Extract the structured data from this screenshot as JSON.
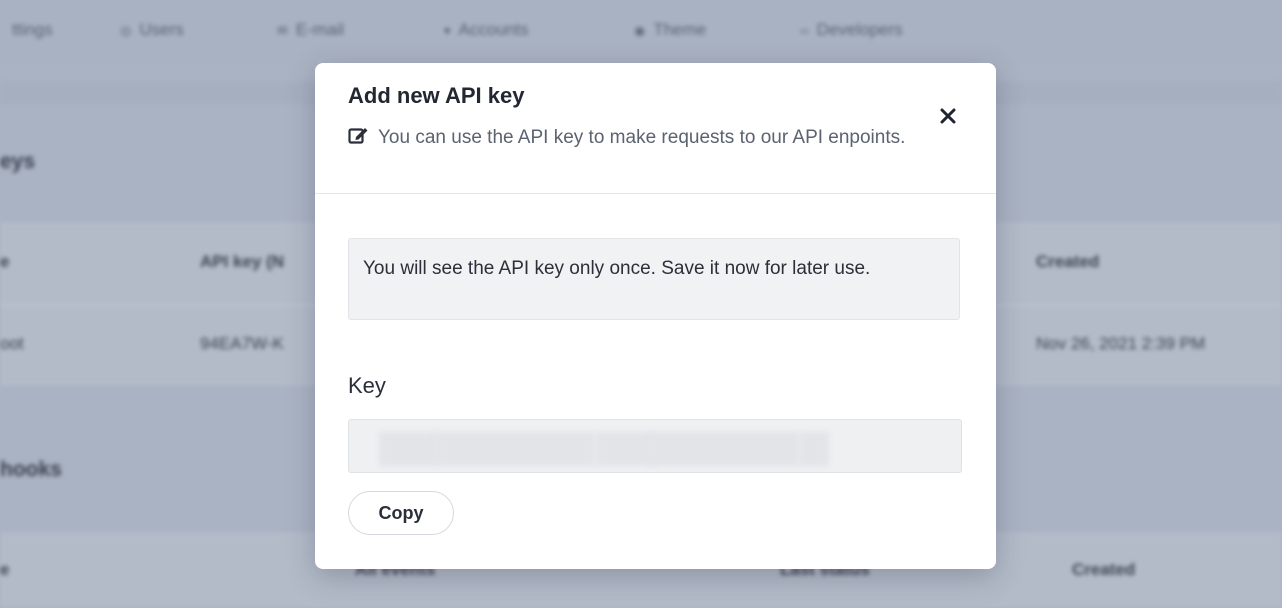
{
  "background": {
    "nav": [
      {
        "icon": "settings-icon",
        "glyph": "",
        "label": "ttings"
      },
      {
        "icon": "users-icon",
        "glyph": "◎",
        "label": "Users"
      },
      {
        "icon": "email-icon",
        "glyph": "✉",
        "label": "E-mail"
      },
      {
        "icon": "accounts-icon",
        "glyph": "▾",
        "label": "Accounts"
      },
      {
        "icon": "theme-icon",
        "glyph": "◉",
        "label": "Theme"
      },
      {
        "icon": "developers-icon",
        "glyph": "‹›",
        "label": "Developers"
      }
    ],
    "section_keys": "eys",
    "table_header": {
      "col1": "e",
      "col2": "API key (N",
      "col3": "Created"
    },
    "table_row": {
      "col1": "oot",
      "col2": "94EA7W-K",
      "col3": "Nov 26, 2021 2:39 PM"
    },
    "section_webhooks": "hooks",
    "webhook_header": {
      "col1": "e",
      "col2": "All events",
      "col3": "Last status",
      "col4": "Created"
    }
  },
  "modal": {
    "title": "Add new API key",
    "close_label": "×",
    "subtitle": "You can use the API key to make requests to our API enpoints.",
    "alert": "You will see the API key only once. Save it now for later use.",
    "key_label": "Key",
    "key_value": "",
    "copy_label": "Copy"
  }
}
